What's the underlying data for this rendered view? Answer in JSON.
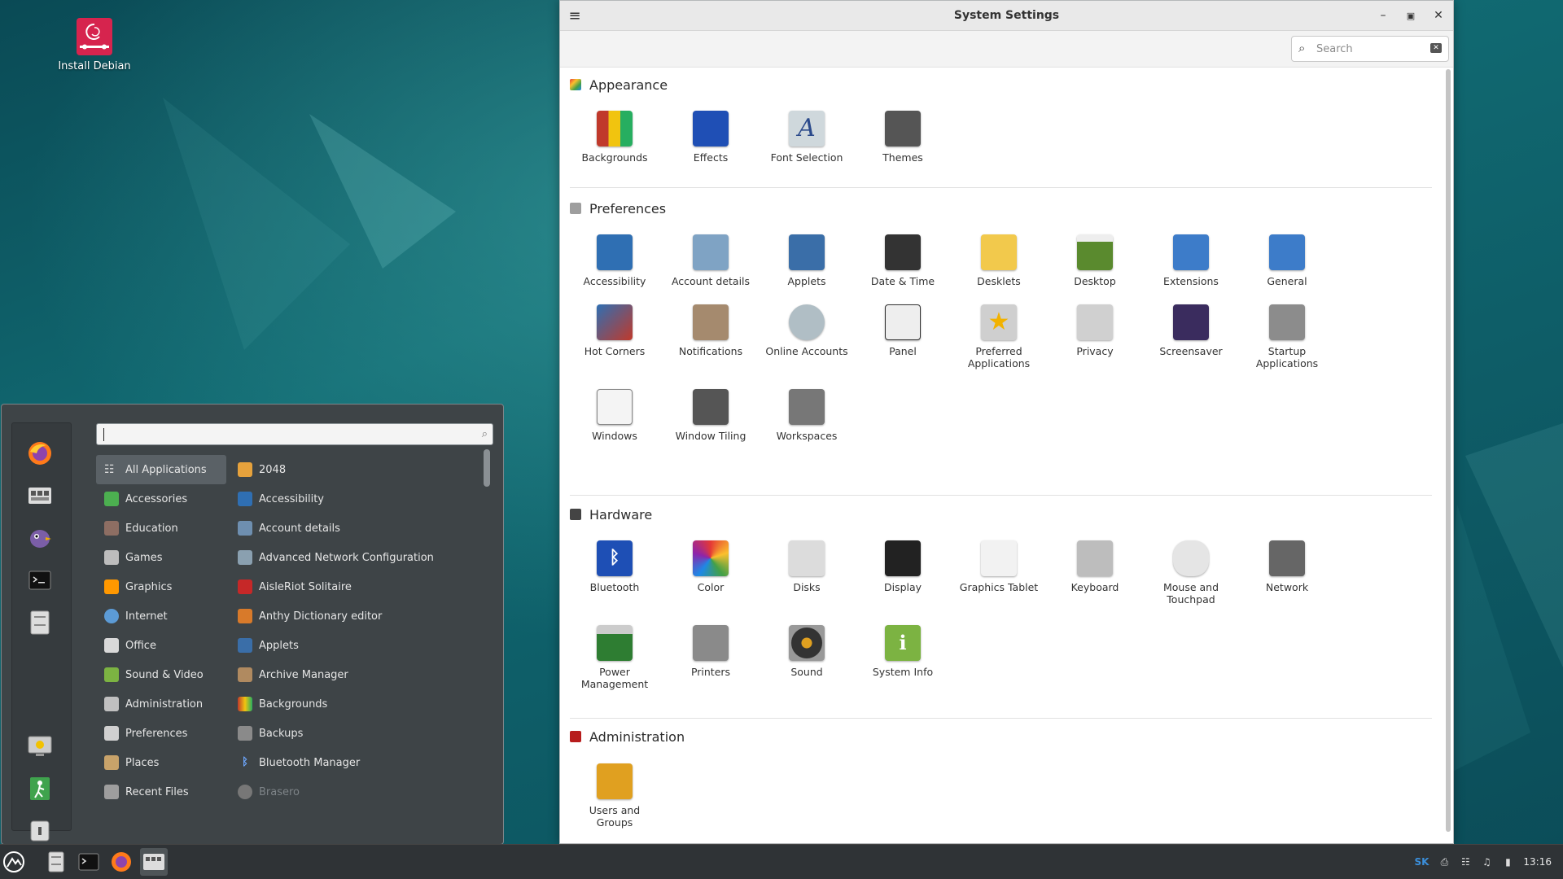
{
  "desktop": {
    "install_label": "Install Debian"
  },
  "menu": {
    "categories": [
      {
        "label": "All Applications",
        "color": "#5a6166"
      },
      {
        "label": "Accessories",
        "color": "#4caf50"
      },
      {
        "label": "Education",
        "color": "#8d6e63"
      },
      {
        "label": "Games",
        "color": "#bdbdbd"
      },
      {
        "label": "Graphics",
        "color": "#ff9800"
      },
      {
        "label": "Internet",
        "color": "#5c9bd6"
      },
      {
        "label": "Office",
        "color": "#d9d9d9"
      },
      {
        "label": "Sound & Video",
        "color": "#7cb342"
      },
      {
        "label": "Administration",
        "color": "#c0c0c0"
      },
      {
        "label": "Preferences",
        "color": "#d0d0d0"
      },
      {
        "label": "Places",
        "color": "#c8a36a"
      },
      {
        "label": "Recent Files",
        "color": "#9e9e9e"
      }
    ],
    "apps": [
      {
        "label": "2048",
        "color": "#e6a23c"
      },
      {
        "label": "Accessibility",
        "color": "#2f6fb3"
      },
      {
        "label": "Account details",
        "color": "#6e8fb0"
      },
      {
        "label": "Advanced Network Configuration",
        "color": "#8aa0b0"
      },
      {
        "label": "AisleRiot Solitaire",
        "color": "#c62828"
      },
      {
        "label": "Anthy Dictionary editor",
        "color": "#d87a2a"
      },
      {
        "label": "Applets",
        "color": "#3a6ea8"
      },
      {
        "label": "Archive Manager",
        "color": "#b08a60"
      },
      {
        "label": "Backgrounds",
        "color": "#c0392b"
      },
      {
        "label": "Backups",
        "color": "#8a8a8a"
      },
      {
        "label": "Bluetooth Manager",
        "color": "#2e6bd6"
      },
      {
        "label": "Brasero",
        "color": "#777777"
      }
    ]
  },
  "window": {
    "title": "System Settings",
    "search_placeholder": "Search",
    "sections": {
      "appearance": "Appearance",
      "preferences": "Preferences",
      "hardware": "Hardware",
      "administration": "Administration"
    },
    "appearance": [
      "Backgrounds",
      "Effects",
      "Font Selection",
      "Themes"
    ],
    "preferences": [
      "Accessibility",
      "Account details",
      "Applets",
      "Date & Time",
      "Desklets",
      "Desktop",
      "Extensions",
      "General",
      "Hot Corners",
      "Notifications",
      "Online Accounts",
      "Panel",
      "Preferred Applications",
      "Privacy",
      "Screensaver",
      "Startup Applications",
      "Windows",
      "Window Tiling",
      "Workspaces"
    ],
    "hardware": [
      "Bluetooth",
      "Color",
      "Disks",
      "Display",
      "Graphics Tablet",
      "Keyboard",
      "Mouse and Touchpad",
      "Network",
      "Power Management",
      "Printers",
      "Sound",
      "System Info"
    ],
    "administration": [
      "Users and Groups"
    ]
  },
  "taskbar": {
    "keyboard_layout": "SK",
    "clock": "13:16"
  }
}
